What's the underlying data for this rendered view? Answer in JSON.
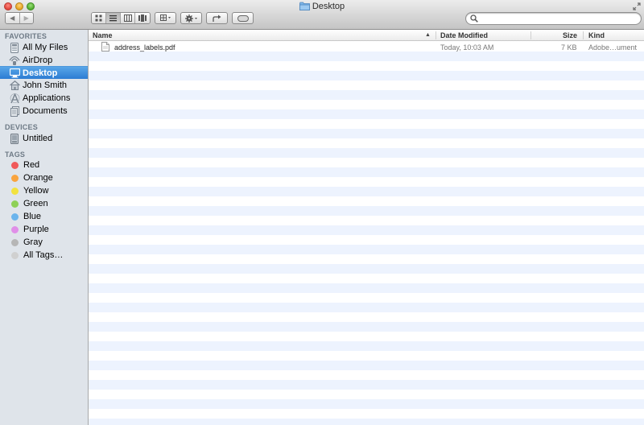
{
  "window": {
    "title": "Desktop"
  },
  "toolbar": {
    "back_label": "◀",
    "forward_label": "▶"
  },
  "search": {
    "placeholder": "",
    "value": ""
  },
  "sidebar": {
    "favorites_header": "FAVORITES",
    "favorites": [
      {
        "label": "All My Files",
        "icon": "all-files-icon"
      },
      {
        "label": "AirDrop",
        "icon": "airdrop-icon"
      },
      {
        "label": "Desktop",
        "icon": "desktop-icon",
        "selected": true
      },
      {
        "label": "John Smith",
        "icon": "home-icon"
      },
      {
        "label": "Applications",
        "icon": "applications-icon"
      },
      {
        "label": "Documents",
        "icon": "documents-icon"
      }
    ],
    "devices_header": "DEVICES",
    "devices": [
      {
        "label": "Untitled",
        "icon": "disk-icon"
      }
    ],
    "tags_header": "TAGS",
    "tags": [
      {
        "label": "Red",
        "color": "#f0595a"
      },
      {
        "label": "Orange",
        "color": "#f9a43f"
      },
      {
        "label": "Yellow",
        "color": "#f2e23f"
      },
      {
        "label": "Green",
        "color": "#8ed056"
      },
      {
        "label": "Blue",
        "color": "#6bb4ec"
      },
      {
        "label": "Purple",
        "color": "#e08fe8"
      },
      {
        "label": "Gray",
        "color": "#b6b6b6"
      },
      {
        "label": "All Tags…",
        "color": "#d0d0d0"
      }
    ]
  },
  "columns": {
    "name": "Name",
    "sort_indicator": "▲",
    "date": "Date Modified",
    "size": "Size",
    "kind": "Kind"
  },
  "files": [
    {
      "name": "address_labels.pdf",
      "date": "Today, 10:03 AM",
      "size": "7 KB",
      "kind": "Adobe…ument",
      "icon": "pdf-file-icon"
    }
  ]
}
